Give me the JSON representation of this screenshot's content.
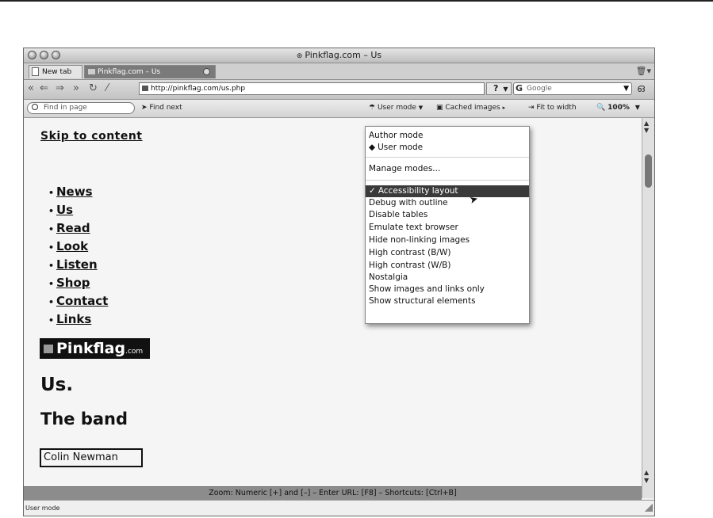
{
  "window": {
    "title": "Pinkflag.com – Us"
  },
  "tabs": [
    {
      "label": "New tab"
    },
    {
      "label": "Pinkflag.com – Us"
    }
  ],
  "address": {
    "url": "http://pinkflag.com/us.php",
    "help": "?",
    "search_engine": "Google"
  },
  "toolbar": {
    "find_placeholder": "Find in page",
    "find_next": "Find next",
    "user_mode": "User mode",
    "cached_images": "Cached images",
    "fit_to_width": "Fit to width",
    "zoom": "100%"
  },
  "menu": {
    "items": [
      {
        "label": "Author mode",
        "mark": ""
      },
      {
        "label": "User mode",
        "mark": "◆"
      },
      {
        "label": "Manage modes...",
        "mark": ""
      },
      {
        "label": "Accessibility layout",
        "mark": "✓"
      },
      {
        "label": "Debug with outline",
        "mark": ""
      },
      {
        "label": "Disable tables",
        "mark": ""
      },
      {
        "label": "Emulate text browser",
        "mark": ""
      },
      {
        "label": "Hide non-linking images",
        "mark": ""
      },
      {
        "label": "High contrast (B/W)",
        "mark": ""
      },
      {
        "label": "High contrast (W/B)",
        "mark": ""
      },
      {
        "label": "Nostalgia",
        "mark": ""
      },
      {
        "label": "Show images and links only",
        "mark": ""
      },
      {
        "label": "Show structural elements",
        "mark": ""
      }
    ]
  },
  "page": {
    "skip_link": "Skip to content",
    "nav": [
      "News",
      "Us",
      "Read",
      "Look",
      "Listen",
      "Shop",
      "Contact",
      "Links"
    ],
    "logo_text": "Pinkflag",
    "logo_suffix": ".com",
    "heading": "Us.",
    "subheading": "The band",
    "member": "Colin  Newman"
  },
  "status": {
    "hint": "Zoom: Numeric [+] and [–] – Enter URL: [F8] – Shortcuts: [Ctrl+B]",
    "mode": "User mode"
  }
}
